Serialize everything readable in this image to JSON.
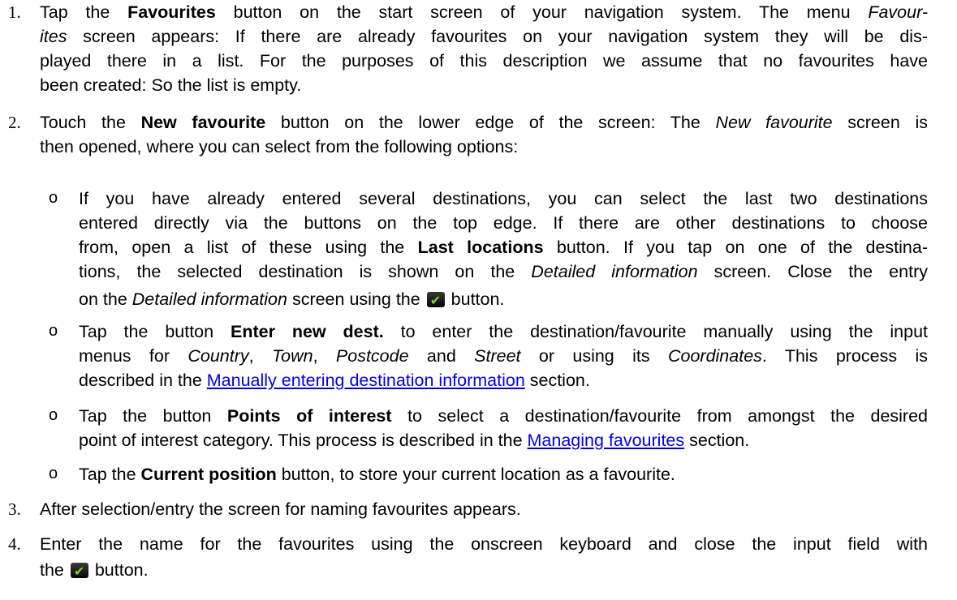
{
  "steps": {
    "s1": {
      "num": "1.",
      "t1": "Tap the ",
      "b1": "Favourites",
      "t2": " button on the start screen of your navigation system. The menu ",
      "i1": "Favour-",
      "i2": "ites",
      "t3": " screen appears: If there are already favourites on your navigation system they will be dis-",
      "l3": "played there in a list. For the purposes of this description we assume that no favourites have",
      "l4": "been created: So the list is empty."
    },
    "s2": {
      "num": "2.",
      "t1": "Touch the ",
      "b1": "New favourite",
      "t2": " button on the lower edge of the screen: The ",
      "i1": "New favourite",
      "t3": " screen is",
      "l2": "then opened, where you can select from the following options:"
    },
    "b1": {
      "bullet": "o",
      "l1": "If you have already entered several destinations, you can select the last two destinations",
      "l2": "entered directly via the buttons on the top edge. If there are other destinations to choose",
      "t3a": "from, open a list of these using the ",
      "b3": "Last locations",
      "t3b": " button. If you tap on one of the destina-",
      "t4a": "tions, the selected destination is shown on the ",
      "i4": "Detailed information",
      "t4b": " screen. Close the entry",
      "t5a": "on the ",
      "i5": "Detailed information",
      "t5b": " screen using the ",
      "t5c": " button."
    },
    "b2": {
      "bullet": "o",
      "t1a": "Tap the button ",
      "b1": "Enter new dest.",
      "t1b": " to enter the destination/favourite manually using the input",
      "t2a": "menus for ",
      "i2a": "Country",
      "t2b": ", ",
      "i2b": "Town",
      "t2c": ", ",
      "i2c": "Postcode",
      "t2d": " and ",
      "i2d": "Street",
      "t2e": " or using its ",
      "i2e": "Coordinates",
      "t2f": ". This process is",
      "t3a": "described in the ",
      "link": "Manually entering destination information",
      "t3b": " section."
    },
    "b3": {
      "bullet": "o",
      "t1a": "Tap the button ",
      "b1": "Points of interest",
      "t1b": " to select a destination/favourite from amongst the desired",
      "t2a": "point of interest category. This process is described in the ",
      "link": "Managing favourites",
      "t2b": " section."
    },
    "b4": {
      "bullet": "o",
      "t1a": "Tap the ",
      "b1": "Current position",
      "t1b": " button, to store your current location as a favourite."
    },
    "s3": {
      "num": "3.",
      "l1": "After selection/entry the screen for naming favourites appears."
    },
    "s4": {
      "num": "4.",
      "l1": "Enter the name for the favourites using the onscreen keyboard and close the input field with",
      "t2a": "the ",
      "t2b": " button."
    }
  },
  "icons": {
    "confirm": "check-button-icon"
  },
  "colors": {
    "link": "#0000ee",
    "check_green": "#7fd320"
  }
}
